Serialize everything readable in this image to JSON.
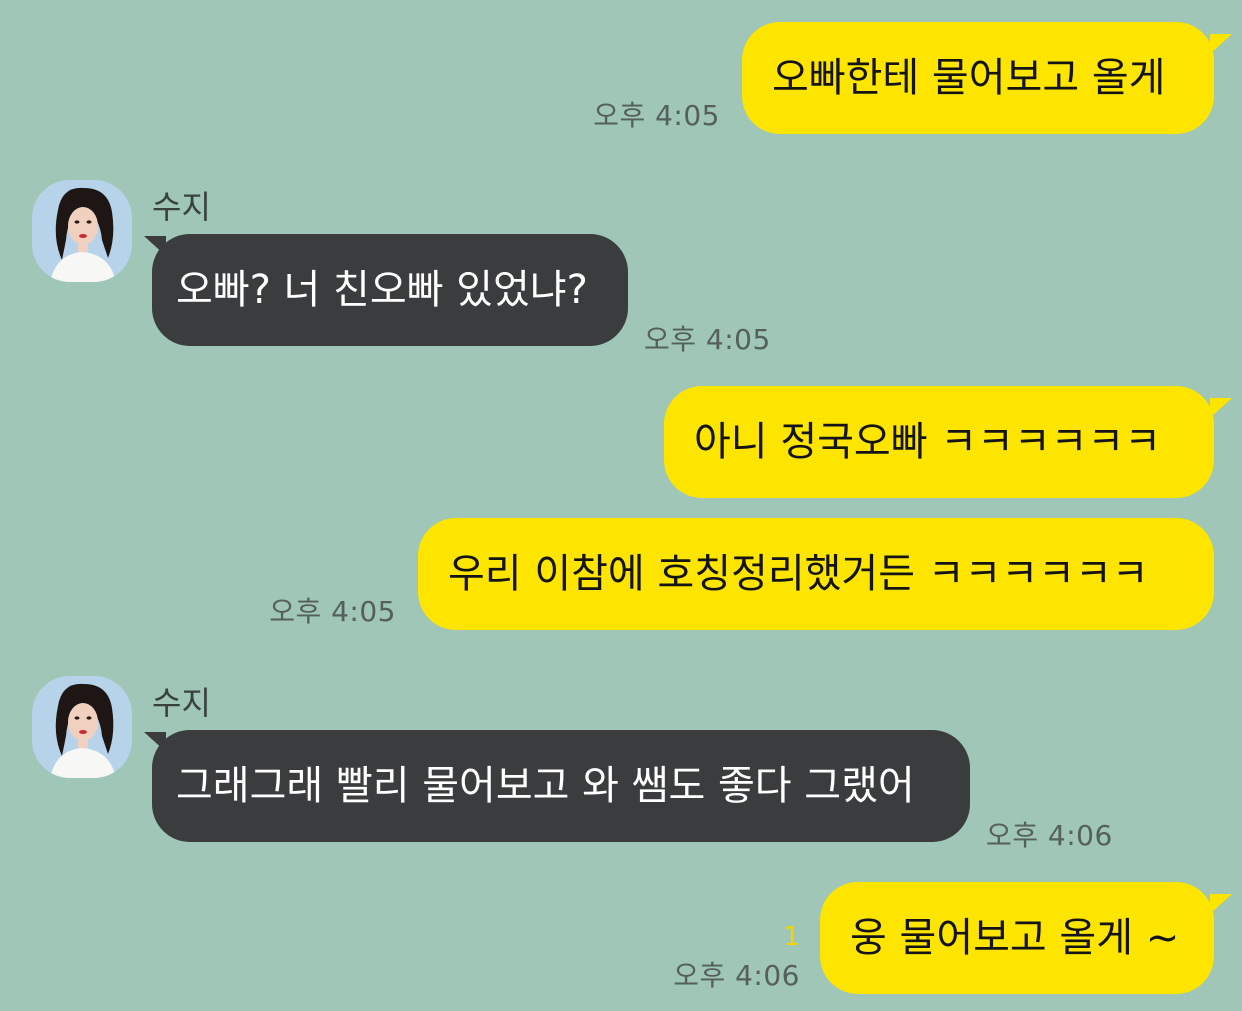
{
  "chat": {
    "messages": [
      {
        "text": "오빠한테 물어보고 올게",
        "time": "오후 4:05"
      },
      {
        "sender": "수지",
        "text": "오빠? 너 친오빠 있었냐?",
        "time": "오후 4:05"
      },
      {
        "text": "아니 정국오빠 ㅋㅋㅋㅋㅋㅋ"
      },
      {
        "text": "우리 이참에 호칭정리했거든 ㅋㅋㅋㅋㅋㅋ",
        "time": "오후 4:05"
      },
      {
        "sender": "수지",
        "text": "그래그래 빨리 물어보고 와 쌤도 좋다 그랬어",
        "time": "오후 4:06"
      },
      {
        "text": "웅 물어보고 올게 ~",
        "time": "오후 4:06",
        "unread": "1"
      }
    ]
  },
  "colors": {
    "background": "#9fc6b6",
    "outgoing_bubble": "#fee500",
    "incoming_bubble": "#3a3c3e",
    "unread_count": "#f5d400"
  }
}
